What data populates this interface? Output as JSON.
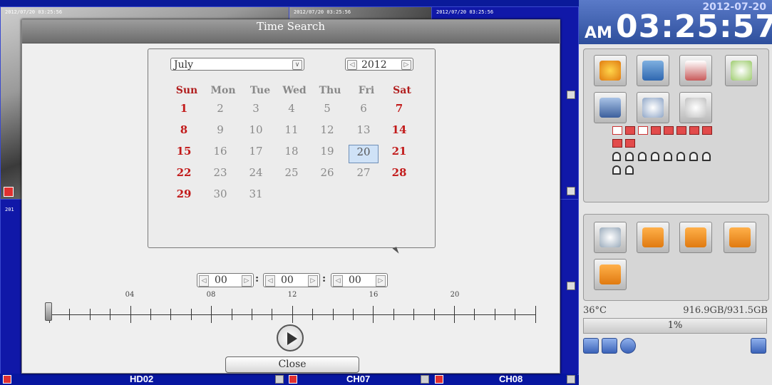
{
  "cameras": {
    "stamps": [
      "2012/07/20 03:25:56",
      "2012/07/20 03:25:56",
      "2012/07/20 03:25:56",
      "201"
    ],
    "bottom_labels": [
      "HD02",
      "CH07",
      "CH08"
    ]
  },
  "clock": {
    "date": "2012-07-20",
    "ampm": "AM",
    "time": "03:25:57"
  },
  "status": {
    "temperature": "36°C",
    "disk": "916.9GB/931.5GB",
    "disk_percent": "1%"
  },
  "dialog": {
    "title": "Time Search",
    "month": "July",
    "year": "2012",
    "weekdays": [
      "Sun",
      "Mon",
      "Tue",
      "Wed",
      "Thu",
      "Fri",
      "Sat"
    ],
    "weeks": [
      [
        "1",
        "2",
        "3",
        "4",
        "5",
        "6",
        "7"
      ],
      [
        "8",
        "9",
        "10",
        "11",
        "12",
        "13",
        "14"
      ],
      [
        "15",
        "16",
        "17",
        "18",
        "19",
        "20",
        "21"
      ],
      [
        "22",
        "23",
        "24",
        "25",
        "26",
        "27",
        "28"
      ],
      [
        "29",
        "30",
        "31",
        "",
        "",
        "",
        ""
      ]
    ],
    "selected_day": "20",
    "hour": "00",
    "minute": "00",
    "second": "00",
    "timeline_labels": [
      "04",
      "08",
      "12",
      "16",
      "20"
    ],
    "close_label": "Close"
  },
  "icons": {
    "control_panel": [
      "playback-icon",
      "backup-icon",
      "log-icon",
      "search-icon",
      "camera-setup-icon",
      "ptz-icon",
      "settings-icon"
    ],
    "layout_panel": [
      "zoom-icon",
      "pip-icon",
      "single-view-icon",
      "quad-view-icon",
      "nine-view-icon"
    ],
    "footer": [
      "network-icon",
      "usb-icon",
      "disc-icon",
      "user-icon"
    ]
  }
}
